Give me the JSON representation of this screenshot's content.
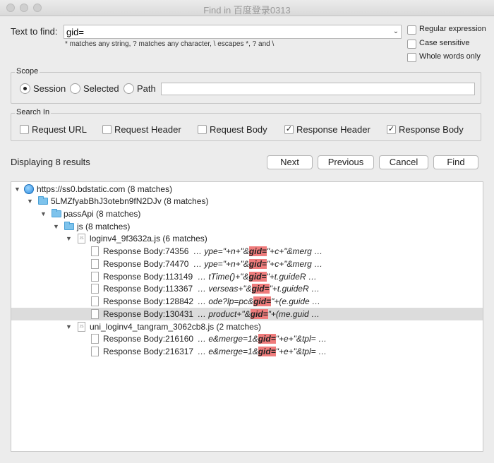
{
  "window": {
    "title": "Find in 百度登录0313"
  },
  "find": {
    "label": "Text to find:",
    "value": "gid=",
    "hint": "* matches any string, ? matches any character, \\ escapes *, ? and \\"
  },
  "options": {
    "regex": "Regular expression",
    "case": "Case sensitive",
    "whole": "Whole words only"
  },
  "scope": {
    "title": "Scope",
    "session": "Session",
    "selected": "Selected",
    "path": "Path",
    "selected_option": "Session"
  },
  "search_in": {
    "title": "Search In",
    "items": [
      {
        "label": "Request URL",
        "checked": false
      },
      {
        "label": "Request Header",
        "checked": false
      },
      {
        "label": "Request Body",
        "checked": false
      },
      {
        "label": "Response Header",
        "checked": true
      },
      {
        "label": "Response Body",
        "checked": true
      }
    ]
  },
  "results": {
    "count_text": "Displaying 8 results"
  },
  "buttons": {
    "next": "Next",
    "previous": "Previous",
    "cancel": "Cancel",
    "find": "Find"
  },
  "tree": {
    "host": "https://ss0.bdstatic.com (8 matches)",
    "folder1": "5LMZfyabBhJ3otebn9fN2DJv (8 matches)",
    "folder2": "passApi (8 matches)",
    "folder3": "js (8 matches)",
    "file1": "loginv4_9f3632a.js (6 matches)",
    "file2": "uni_loginv4_tangram_3062cb8.js (2 matches)",
    "matches1": [
      {
        "label": "Response Body:74356",
        "pre": "… ype=\"+n+\"&",
        "hit": "gid=",
        "post": "\"+c+\"&merg …"
      },
      {
        "label": "Response Body:74470",
        "pre": "… ype=\"+n+\"&",
        "hit": "gid=",
        "post": "\"+c+\"&merg …"
      },
      {
        "label": "Response Body:113149",
        "pre": "… tTime()+\"&",
        "hit": "gid=",
        "post": "\"+t.guideR …"
      },
      {
        "label": "Response Body:113367",
        "pre": "… verseas+\"&",
        "hit": "gid=",
        "post": "\"+t.guideR …"
      },
      {
        "label": "Response Body:128842",
        "pre": "… ode?lp=pc&",
        "hit": "gid=",
        "post": "\"+(e.guide …"
      },
      {
        "label": "Response Body:130431",
        "pre": "… product+\"&",
        "hit": "gid=",
        "post": "\"+(me.guid …"
      }
    ],
    "matches2": [
      {
        "label": "Response Body:216160",
        "pre": "… e&merge=1&",
        "hit": "gid=",
        "post": "\"+e+\"&tpl= …"
      },
      {
        "label": "Response Body:216317",
        "pre": "… e&merge=1&",
        "hit": "gid=",
        "post": "\"+e+\"&tpl= …"
      }
    ]
  }
}
